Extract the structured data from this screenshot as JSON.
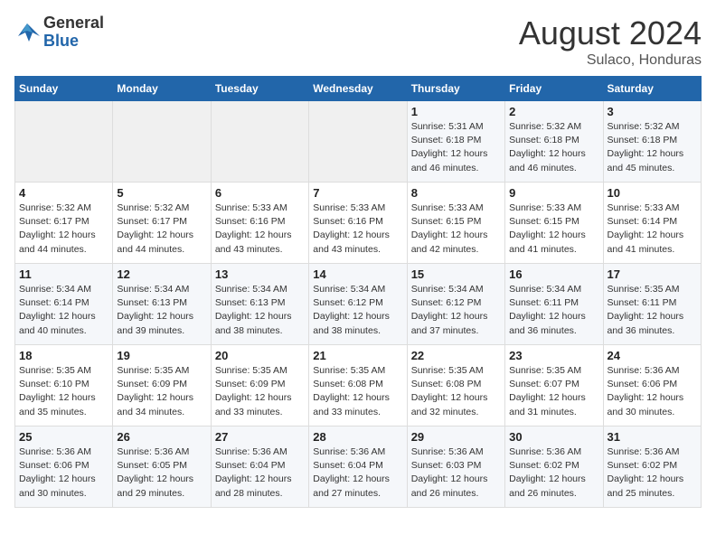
{
  "header": {
    "logo_general": "General",
    "logo_blue": "Blue",
    "main_title": "August 2024",
    "subtitle": "Sulaco, Honduras"
  },
  "days_of_week": [
    "Sunday",
    "Monday",
    "Tuesday",
    "Wednesday",
    "Thursday",
    "Friday",
    "Saturday"
  ],
  "weeks": [
    [
      {
        "day": "",
        "detail": ""
      },
      {
        "day": "",
        "detail": ""
      },
      {
        "day": "",
        "detail": ""
      },
      {
        "day": "",
        "detail": ""
      },
      {
        "day": "1",
        "detail": "Sunrise: 5:31 AM\nSunset: 6:18 PM\nDaylight: 12 hours\nand 46 minutes."
      },
      {
        "day": "2",
        "detail": "Sunrise: 5:32 AM\nSunset: 6:18 PM\nDaylight: 12 hours\nand 46 minutes."
      },
      {
        "day": "3",
        "detail": "Sunrise: 5:32 AM\nSunset: 6:18 PM\nDaylight: 12 hours\nand 45 minutes."
      }
    ],
    [
      {
        "day": "4",
        "detail": "Sunrise: 5:32 AM\nSunset: 6:17 PM\nDaylight: 12 hours\nand 44 minutes."
      },
      {
        "day": "5",
        "detail": "Sunrise: 5:32 AM\nSunset: 6:17 PM\nDaylight: 12 hours\nand 44 minutes."
      },
      {
        "day": "6",
        "detail": "Sunrise: 5:33 AM\nSunset: 6:16 PM\nDaylight: 12 hours\nand 43 minutes."
      },
      {
        "day": "7",
        "detail": "Sunrise: 5:33 AM\nSunset: 6:16 PM\nDaylight: 12 hours\nand 43 minutes."
      },
      {
        "day": "8",
        "detail": "Sunrise: 5:33 AM\nSunset: 6:15 PM\nDaylight: 12 hours\nand 42 minutes."
      },
      {
        "day": "9",
        "detail": "Sunrise: 5:33 AM\nSunset: 6:15 PM\nDaylight: 12 hours\nand 41 minutes."
      },
      {
        "day": "10",
        "detail": "Sunrise: 5:33 AM\nSunset: 6:14 PM\nDaylight: 12 hours\nand 41 minutes."
      }
    ],
    [
      {
        "day": "11",
        "detail": "Sunrise: 5:34 AM\nSunset: 6:14 PM\nDaylight: 12 hours\nand 40 minutes."
      },
      {
        "day": "12",
        "detail": "Sunrise: 5:34 AM\nSunset: 6:13 PM\nDaylight: 12 hours\nand 39 minutes."
      },
      {
        "day": "13",
        "detail": "Sunrise: 5:34 AM\nSunset: 6:13 PM\nDaylight: 12 hours\nand 38 minutes."
      },
      {
        "day": "14",
        "detail": "Sunrise: 5:34 AM\nSunset: 6:12 PM\nDaylight: 12 hours\nand 38 minutes."
      },
      {
        "day": "15",
        "detail": "Sunrise: 5:34 AM\nSunset: 6:12 PM\nDaylight: 12 hours\nand 37 minutes."
      },
      {
        "day": "16",
        "detail": "Sunrise: 5:34 AM\nSunset: 6:11 PM\nDaylight: 12 hours\nand 36 minutes."
      },
      {
        "day": "17",
        "detail": "Sunrise: 5:35 AM\nSunset: 6:11 PM\nDaylight: 12 hours\nand 36 minutes."
      }
    ],
    [
      {
        "day": "18",
        "detail": "Sunrise: 5:35 AM\nSunset: 6:10 PM\nDaylight: 12 hours\nand 35 minutes."
      },
      {
        "day": "19",
        "detail": "Sunrise: 5:35 AM\nSunset: 6:09 PM\nDaylight: 12 hours\nand 34 minutes."
      },
      {
        "day": "20",
        "detail": "Sunrise: 5:35 AM\nSunset: 6:09 PM\nDaylight: 12 hours\nand 33 minutes."
      },
      {
        "day": "21",
        "detail": "Sunrise: 5:35 AM\nSunset: 6:08 PM\nDaylight: 12 hours\nand 33 minutes."
      },
      {
        "day": "22",
        "detail": "Sunrise: 5:35 AM\nSunset: 6:08 PM\nDaylight: 12 hours\nand 32 minutes."
      },
      {
        "day": "23",
        "detail": "Sunrise: 5:35 AM\nSunset: 6:07 PM\nDaylight: 12 hours\nand 31 minutes."
      },
      {
        "day": "24",
        "detail": "Sunrise: 5:36 AM\nSunset: 6:06 PM\nDaylight: 12 hours\nand 30 minutes."
      }
    ],
    [
      {
        "day": "25",
        "detail": "Sunrise: 5:36 AM\nSunset: 6:06 PM\nDaylight: 12 hours\nand 30 minutes."
      },
      {
        "day": "26",
        "detail": "Sunrise: 5:36 AM\nSunset: 6:05 PM\nDaylight: 12 hours\nand 29 minutes."
      },
      {
        "day": "27",
        "detail": "Sunrise: 5:36 AM\nSunset: 6:04 PM\nDaylight: 12 hours\nand 28 minutes."
      },
      {
        "day": "28",
        "detail": "Sunrise: 5:36 AM\nSunset: 6:04 PM\nDaylight: 12 hours\nand 27 minutes."
      },
      {
        "day": "29",
        "detail": "Sunrise: 5:36 AM\nSunset: 6:03 PM\nDaylight: 12 hours\nand 26 minutes."
      },
      {
        "day": "30",
        "detail": "Sunrise: 5:36 AM\nSunset: 6:02 PM\nDaylight: 12 hours\nand 26 minutes."
      },
      {
        "day": "31",
        "detail": "Sunrise: 5:36 AM\nSunset: 6:02 PM\nDaylight: 12 hours\nand 25 minutes."
      }
    ]
  ]
}
